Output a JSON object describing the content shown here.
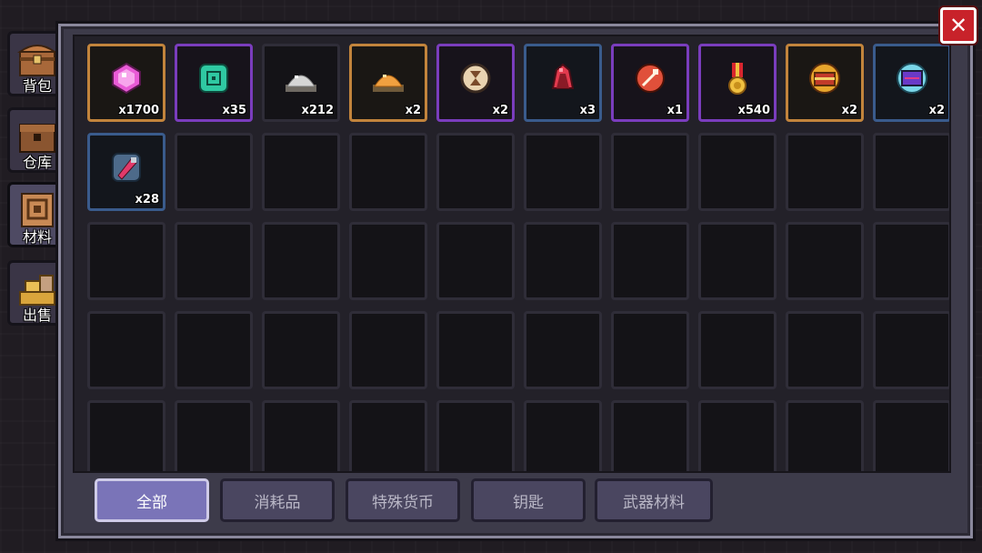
{
  "side_tabs": [
    {
      "label": "背包",
      "icon": "treasure-chest-icon",
      "active": false
    },
    {
      "label": "仓库",
      "icon": "storage-chest-icon",
      "active": false
    },
    {
      "label": "材料",
      "icon": "materials-box-icon",
      "active": true
    },
    {
      "label": "出售",
      "icon": "gold-pile-icon",
      "active": false
    }
  ],
  "close_label": "✕",
  "items": [
    {
      "icon": "pink-gem-icon",
      "count": "x1700",
      "rarity": "orange"
    },
    {
      "icon": "jade-coin-icon",
      "count": "x35",
      "rarity": "purple"
    },
    {
      "icon": "silver-ore-pile-icon",
      "count": "x212",
      "rarity": "default"
    },
    {
      "icon": "gold-ore-pile-icon",
      "count": "x2",
      "rarity": "orange"
    },
    {
      "icon": "hourglass-token-icon",
      "count": "x2",
      "rarity": "purple"
    },
    {
      "icon": "red-crystal-icon",
      "count": "x3",
      "rarity": "blue"
    },
    {
      "icon": "red-rune-icon",
      "count": "x1",
      "rarity": "purple"
    },
    {
      "icon": "medal-icon",
      "count": "x540",
      "rarity": "purple"
    },
    {
      "icon": "golden-chest-icon",
      "count": "x2",
      "rarity": "orange"
    },
    {
      "icon": "tech-chip-icon",
      "count": "x2",
      "rarity": "blue"
    },
    {
      "icon": "drill-bit-icon",
      "count": "x28",
      "rarity": "blue"
    }
  ],
  "filters": [
    {
      "label": "全部",
      "active": true
    },
    {
      "label": "消耗品",
      "active": false
    },
    {
      "label": "特殊货币",
      "active": false
    },
    {
      "label": "钥匙",
      "active": false
    },
    {
      "label": "武器材料",
      "active": false
    }
  ]
}
